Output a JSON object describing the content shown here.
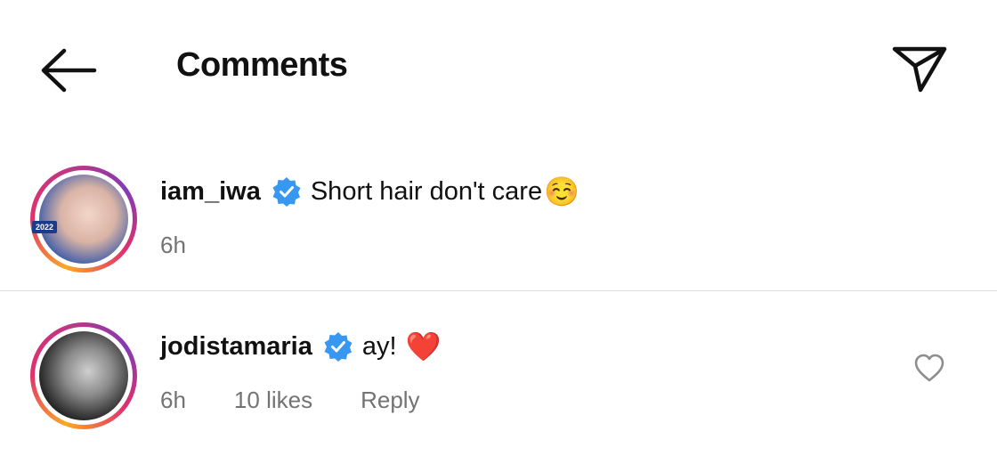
{
  "header": {
    "title": "Comments",
    "back_icon": "arrow-left-icon",
    "share_icon": "paper-plane-icon"
  },
  "comments": [
    {
      "username": "iam_iwa",
      "verified": true,
      "text": "Short hair don't care",
      "emoji": "☺️",
      "time": "6h",
      "avatar_badge": "2022"
    },
    {
      "username": "jodistamaria",
      "verified": true,
      "text": "ay!",
      "emoji": "❤️",
      "time": "6h",
      "likes": "10 likes",
      "reply": "Reply",
      "like_icon": "heart-outline-icon"
    }
  ],
  "colors": {
    "verified_blue": "#3897f0",
    "meta_gray": "#737373",
    "divider": "#dbdbdb",
    "heart_red": "#e0245e"
  }
}
